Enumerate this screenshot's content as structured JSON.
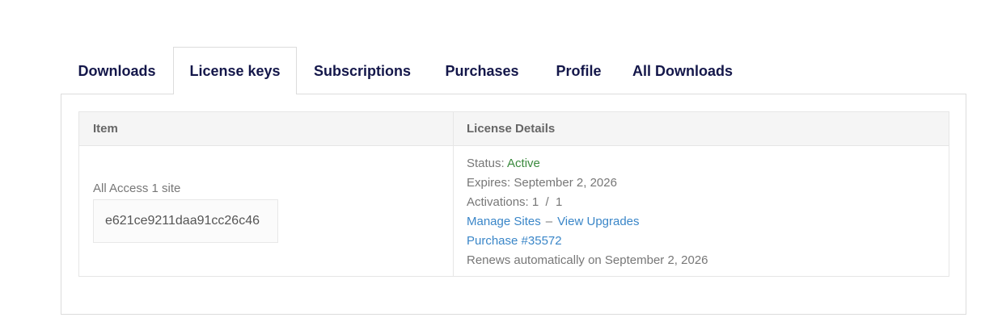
{
  "tabs": [
    {
      "label": "Downloads",
      "active": false
    },
    {
      "label": "License keys",
      "active": true
    },
    {
      "label": "Subscriptions",
      "active": false
    },
    {
      "label": "Purchases",
      "active": false
    },
    {
      "label": "Profile",
      "active": false
    },
    {
      "label": "All Downloads",
      "active": false
    }
  ],
  "table": {
    "headers": {
      "item": "Item",
      "details": "License Details"
    },
    "row": {
      "item_name": "All Access 1 site",
      "license_key": "e621ce9211daa91cc26c46",
      "status_label": "Status:",
      "status_value": "Active",
      "expires_label": "Expires:",
      "expires_value": "September 2, 2026",
      "activations_label": "Activations:",
      "activations_value": "1  /  1",
      "manage_sites": "Manage Sites",
      "separator": "–",
      "view_upgrades": "View Upgrades",
      "purchase_link": "Purchase #35572",
      "renews_text": "Renews automatically on September 2, 2026"
    }
  },
  "colors": {
    "tab_text": "#14174a",
    "link": "#3a86c8",
    "active_status": "#3b8a3e",
    "annotation_arrow": "#e31b1b"
  }
}
